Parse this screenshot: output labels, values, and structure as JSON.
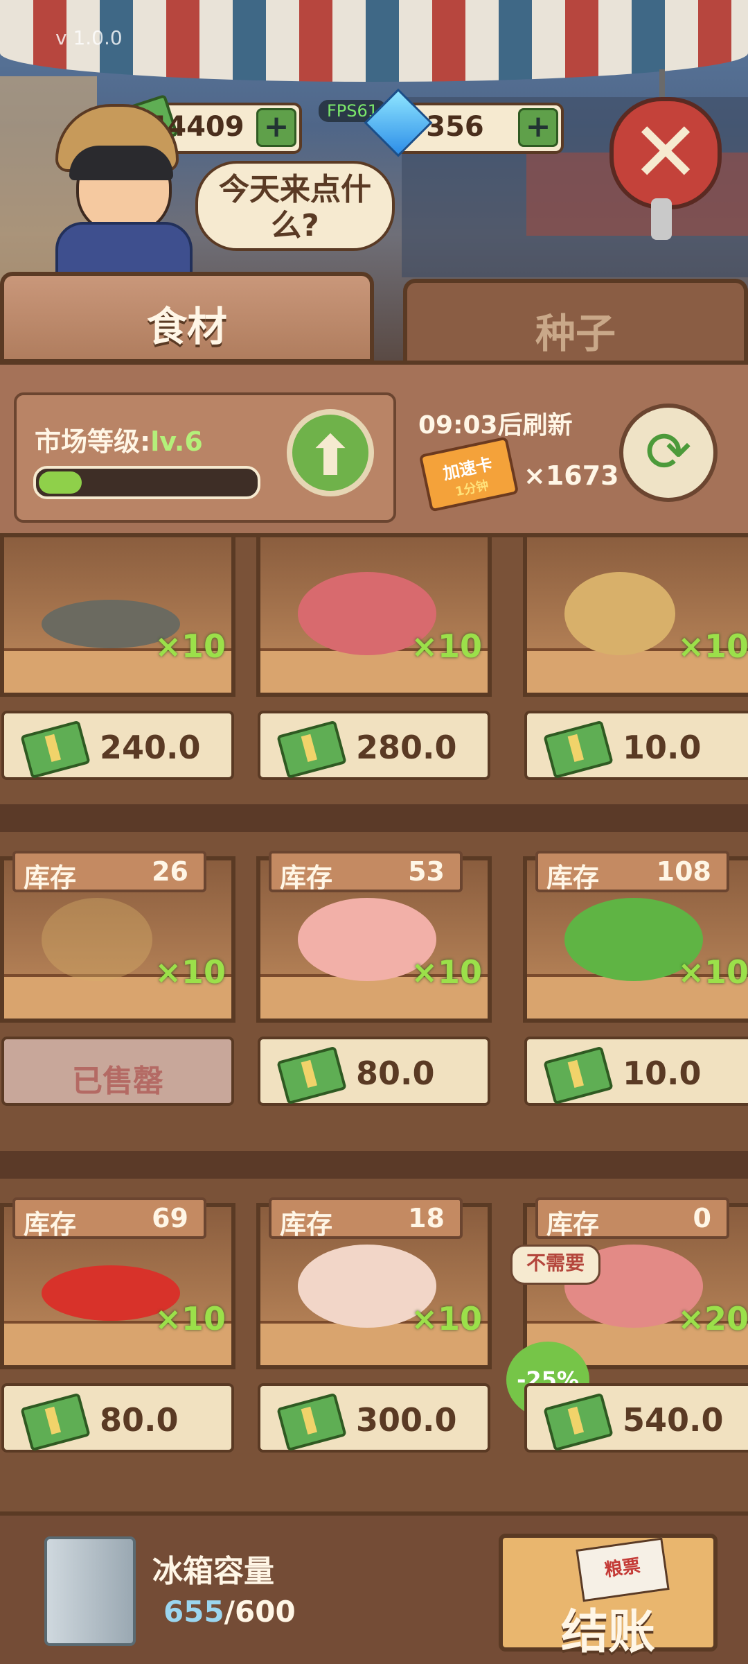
{
  "version": "v 1.0.0",
  "fps": "FPS61",
  "resources": {
    "money": "44409",
    "diamonds": "356",
    "plus": "+"
  },
  "greeting": "今天来点什么?",
  "close_label": "✕",
  "tabs": [
    {
      "label": "食材",
      "active": true
    },
    {
      "label": "种子",
      "active": false
    }
  ],
  "market": {
    "level_label": "市场等级:",
    "level_value": "lv.6",
    "level_progress": 0.2,
    "refresh_text": "09:03后刷新",
    "speed_card_label": "加速卡",
    "speed_card_sub": "1分钟",
    "speed_card_count": "×1673"
  },
  "stock_label": "库存",
  "items": [
    {
      "name": "fish",
      "stock": "",
      "qty": "×10",
      "price": "240.0",
      "sold": false
    },
    {
      "name": "meat",
      "stock": "",
      "qty": "×10",
      "price": "280.0",
      "sold": false
    },
    {
      "name": "scallion-ginger-garlic",
      "stock": "",
      "qty": "×10",
      "price": "10.0",
      "sold": false
    },
    {
      "name": "scallion-ginger-garlic",
      "stock": "26",
      "qty": "×10",
      "price": "",
      "sold": true,
      "sold_label": "已售罄"
    },
    {
      "name": "chicken-leg",
      "stock": "53",
      "qty": "×10",
      "price": "80.0",
      "sold": false
    },
    {
      "name": "bok-choy",
      "stock": "108",
      "qty": "×10",
      "price": "10.0",
      "sold": false
    },
    {
      "name": "chili-pepper",
      "stock": "69",
      "qty": "×10",
      "price": "80.0",
      "sold": false
    },
    {
      "name": "scallop",
      "stock": "18",
      "qty": "×10",
      "price": "300.0",
      "sold": false
    },
    {
      "name": "offal",
      "stock": "0",
      "qty": "×20",
      "price": "540.0",
      "sold": false,
      "tooltip": "不需要",
      "discount": "-25%"
    }
  ],
  "fridge": {
    "label": "冰箱容量",
    "used": "655",
    "capacity": "/600"
  },
  "checkout": {
    "coupon": "粮票",
    "label": "结账"
  }
}
